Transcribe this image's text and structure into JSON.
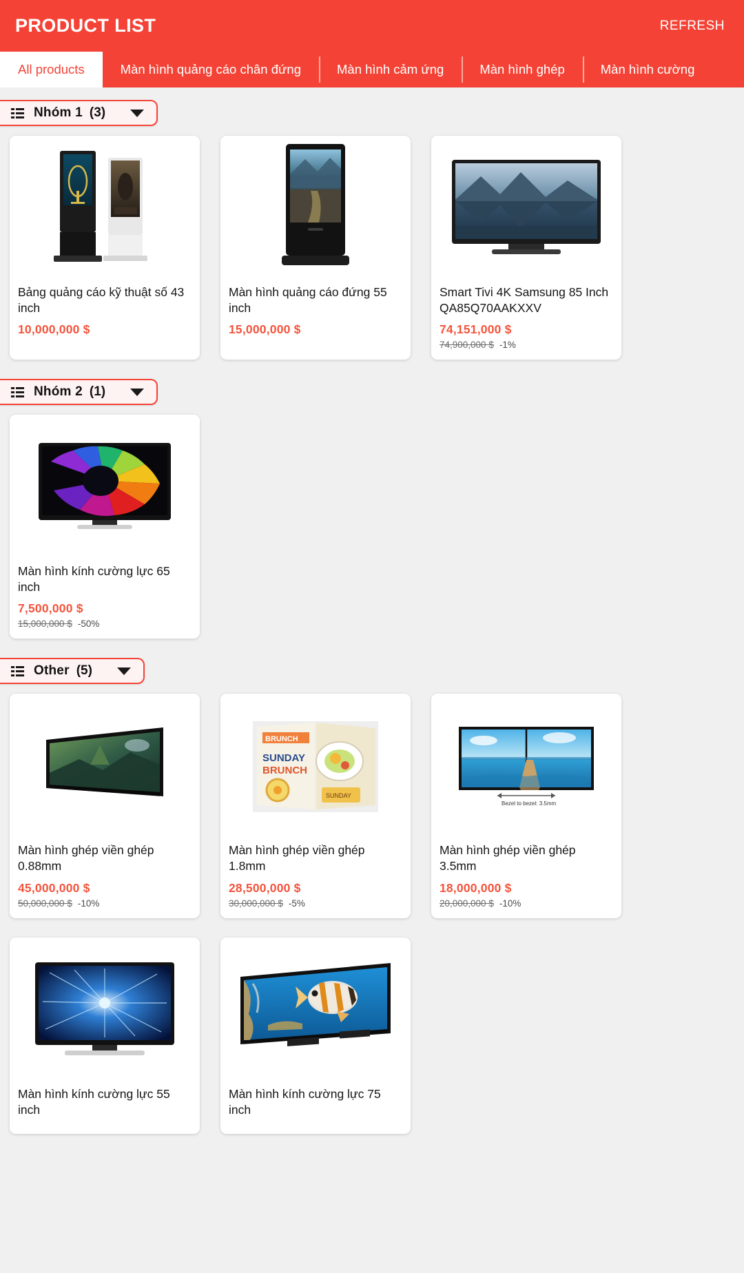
{
  "header": {
    "title": "PRODUCT LIST",
    "refresh_label": "REFRESH",
    "bg_color": "#f44336",
    "text_color": "#ffffff"
  },
  "tabs": [
    {
      "label": "All products",
      "active": true
    },
    {
      "label": "Màn hình quảng cáo chân đứng",
      "active": false
    },
    {
      "label": "Màn hình cảm ứng",
      "active": false
    },
    {
      "label": "Màn hình ghép",
      "active": false
    },
    {
      "label": "Màn hình cường",
      "active": false
    }
  ],
  "colors": {
    "accent": "#f44336",
    "price": "#f4543c",
    "page_bg": "#f0f0f0",
    "card_bg": "#ffffff",
    "chip_bg": "#fdf3f2"
  },
  "groups": [
    {
      "name": "Nhóm 1",
      "count": "(3)",
      "icon": "list-icon",
      "caret": "chevron-down-icon",
      "products": [
        {
          "title": "Bảng quảng cáo kỹ thuật số 43 inch",
          "price": "10,000,000 $",
          "old_price": "",
          "discount": "",
          "image": "dual-standing-kiosk-image"
        },
        {
          "title": "Màn hình quảng cáo đứng 55 inch",
          "price": "15,000,000 $",
          "old_price": "",
          "discount": "",
          "image": "standing-kiosk-landscape-image"
        },
        {
          "title": "Smart Tivi 4K Samsung 85 Inch QA85Q70AAKXXV",
          "price": "74,151,000 $",
          "old_price": "74,900,000 $",
          "discount": "-1%",
          "image": "tv-mountain-lake-image"
        }
      ]
    },
    {
      "name": "Nhóm 2",
      "count": "(1)",
      "icon": "list-icon",
      "caret": "chevron-down-icon",
      "products": [
        {
          "title": "Màn hình kính cường lực 65 inch",
          "price": "7,500,000 $",
          "old_price": "15,000,000 $",
          "discount": "-50%",
          "image": "tv-rainbow-swirl-image"
        }
      ]
    },
    {
      "name": "Other",
      "count": "(5)",
      "icon": "list-icon",
      "caret": "chevron-down-icon",
      "products": [
        {
          "title": "Màn hình ghép viền ghép 0.88mm",
          "price": "45,000,000 $",
          "old_price": "50,000,000 $",
          "discount": "-10%",
          "image": "videowall-forest-image"
        },
        {
          "title": "Màn hình ghép viền ghép 1.8mm",
          "price": "28,500,000 $",
          "old_price": "30,000,000 $",
          "discount": "-5%",
          "image": "videowall-brunch-poster-image"
        },
        {
          "title": "Màn hình ghép viền ghép 3.5mm",
          "price": "18,000,000 $",
          "old_price": "20,000,000 $",
          "discount": "-10%",
          "image": "videowall-beach-pier-image"
        },
        {
          "title": "Màn hình kính cường lực 55 inch",
          "price": "",
          "old_price": "",
          "discount": "",
          "image": "tv-blue-burst-image"
        },
        {
          "title": "Màn hình kính cường lực 75 inch",
          "price": "",
          "old_price": "",
          "discount": "",
          "image": "tv-fish-image"
        }
      ]
    }
  ]
}
